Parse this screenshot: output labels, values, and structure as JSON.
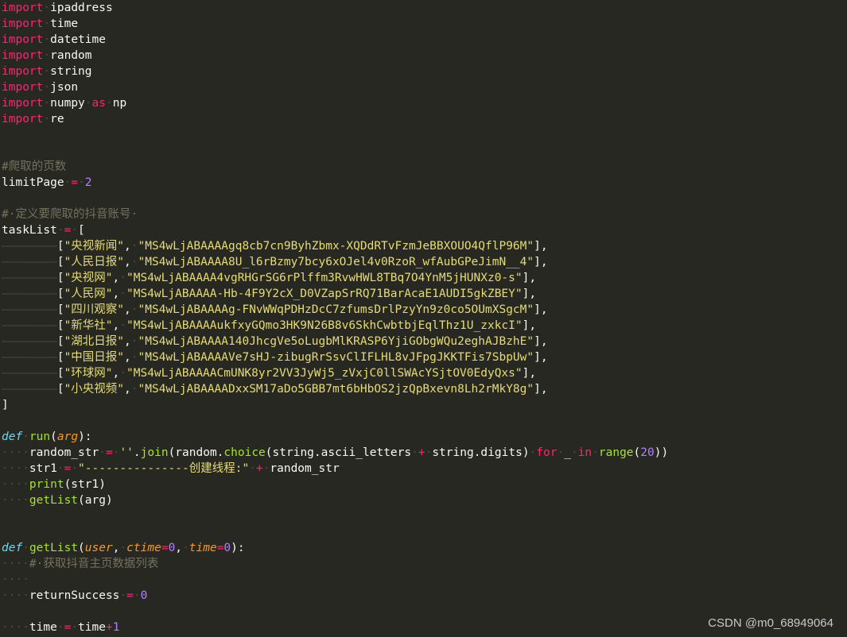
{
  "code": {
    "lines": [
      [
        [
          "kw",
          "import"
        ],
        [
          "ws",
          "·"
        ],
        [
          "t",
          "ipaddress"
        ]
      ],
      [
        [
          "kw",
          "import"
        ],
        [
          "ws",
          "·"
        ],
        [
          "t",
          "time"
        ]
      ],
      [
        [
          "kw",
          "import"
        ],
        [
          "ws",
          "·"
        ],
        [
          "t",
          "datetime"
        ]
      ],
      [
        [
          "kw",
          "import"
        ],
        [
          "ws",
          "·"
        ],
        [
          "t",
          "random"
        ]
      ],
      [
        [
          "kw",
          "import"
        ],
        [
          "ws",
          "·"
        ],
        [
          "t",
          "string"
        ]
      ],
      [
        [
          "kw",
          "import"
        ],
        [
          "ws",
          "·"
        ],
        [
          "t",
          "json"
        ]
      ],
      [
        [
          "kw",
          "import"
        ],
        [
          "ws",
          "·"
        ],
        [
          "t",
          "numpy"
        ],
        [
          "ws",
          "·"
        ],
        [
          "kw",
          "as"
        ],
        [
          "ws",
          "·"
        ],
        [
          "t",
          "np"
        ]
      ],
      [
        [
          "kw",
          "import"
        ],
        [
          "ws",
          "·"
        ],
        [
          "t",
          "re"
        ]
      ],
      [],
      [],
      [
        [
          "cmt",
          "#爬取的页数"
        ]
      ],
      [
        [
          "t",
          "limitPage"
        ],
        [
          "ws",
          "·"
        ],
        [
          "kw",
          "="
        ],
        [
          "ws",
          "·"
        ],
        [
          "num",
          "2"
        ]
      ],
      [],
      [
        [
          "cmt",
          "#·定义要爬取的抖音账号·"
        ]
      ],
      [
        [
          "t",
          "taskList"
        ],
        [
          "ws",
          "·"
        ],
        [
          "kw",
          "="
        ],
        [
          "ws",
          "·"
        ],
        [
          "t",
          "["
        ]
      ],
      [
        [
          "ws",
          "————————"
        ],
        [
          "t",
          "["
        ],
        [
          "str",
          "\"央视新闻\""
        ],
        [
          "t",
          ","
        ],
        [
          "ws",
          "·"
        ],
        [
          "str",
          "\"MS4wLjABAAAAgq8cb7cn9ByhZbmx-XQDdRTvFzmJeBBXOUO4QflP96M\""
        ],
        [
          "t",
          "],"
        ]
      ],
      [
        [
          "ws",
          "————————"
        ],
        [
          "t",
          "["
        ],
        [
          "str",
          "\"人民日报\""
        ],
        [
          "t",
          ","
        ],
        [
          "ws",
          "·"
        ],
        [
          "str",
          "\"MS4wLjABAAAA8U_l6rBzmy7bcy6xOJel4v0RzoR_wfAubGPeJimN__4\""
        ],
        [
          "t",
          "],"
        ]
      ],
      [
        [
          "ws",
          "————————"
        ],
        [
          "t",
          "["
        ],
        [
          "str",
          "\"央视网\""
        ],
        [
          "t",
          ","
        ],
        [
          "ws",
          "·"
        ],
        [
          "str",
          "\"MS4wLjABAAAA4vgRHGrSG6rPlffm3RvwHWL8TBq7O4YnM5jHUNXz0-s\""
        ],
        [
          "t",
          "],"
        ]
      ],
      [
        [
          "ws",
          "————————"
        ],
        [
          "t",
          "["
        ],
        [
          "str",
          "\"人民网\""
        ],
        [
          "t",
          ","
        ],
        [
          "ws",
          "·"
        ],
        [
          "str",
          "\"MS4wLjABAAAA-Hb-4F9Y2cX_D0VZapSrRQ71BarAcaE1AUDI5gkZBEY\""
        ],
        [
          "t",
          "],"
        ]
      ],
      [
        [
          "ws",
          "————————"
        ],
        [
          "t",
          "["
        ],
        [
          "str",
          "\"四川观察\""
        ],
        [
          "t",
          ","
        ],
        [
          "ws",
          "·"
        ],
        [
          "str",
          "\"MS4wLjABAAAAg-FNvWWqPDHzDcC7zfumsDrlPzyYn9z0co5OUmXSgcM\""
        ],
        [
          "t",
          "],"
        ]
      ],
      [
        [
          "ws",
          "————————"
        ],
        [
          "t",
          "["
        ],
        [
          "str",
          "\"新华社\""
        ],
        [
          "t",
          ","
        ],
        [
          "ws",
          "·"
        ],
        [
          "str",
          "\"MS4wLjABAAAAukfxyGQmo3HK9N26B8v6SkhCwbtbjEqlThz1U_zxkcI\""
        ],
        [
          "t",
          "],"
        ]
      ],
      [
        [
          "ws",
          "————————"
        ],
        [
          "t",
          "["
        ],
        [
          "str",
          "\"湖北日报\""
        ],
        [
          "t",
          ","
        ],
        [
          "ws",
          "·"
        ],
        [
          "str",
          "\"MS4wLjABAAAA140JhcgVe5oLugbMlKRASP6YjiGObgWQu2eghAJBzhE\""
        ],
        [
          "t",
          "],"
        ]
      ],
      [
        [
          "ws",
          "————————"
        ],
        [
          "t",
          "["
        ],
        [
          "str",
          "\"中国日报\""
        ],
        [
          "t",
          ","
        ],
        [
          "ws",
          "·"
        ],
        [
          "str",
          "\"MS4wLjABAAAAVe7sHJ-zibugRrSsvClIFLHL8vJFpgJKKTFis7SbpUw\""
        ],
        [
          "t",
          "],"
        ]
      ],
      [
        [
          "ws",
          "————————"
        ],
        [
          "t",
          "["
        ],
        [
          "str",
          "\"环球网\""
        ],
        [
          "t",
          ","
        ],
        [
          "ws",
          "·"
        ],
        [
          "str",
          "\"MS4wLjABAAAACmUNK8yr2VV3JyWj5_zVxjC0llSWAcYSjtOV0EdyQxs\""
        ],
        [
          "t",
          "],"
        ]
      ],
      [
        [
          "ws",
          "————————"
        ],
        [
          "t",
          "["
        ],
        [
          "str",
          "\"小央视频\""
        ],
        [
          "t",
          ","
        ],
        [
          "ws",
          "·"
        ],
        [
          "str",
          "\"MS4wLjABAAAADxxSM17aDo5GBB7mt6bHbOS2jzQpBxevn8Lh2rMkY8g\""
        ],
        [
          "t",
          "],"
        ]
      ],
      [
        [
          "t",
          "]"
        ]
      ],
      [],
      [
        [
          "def",
          "def"
        ],
        [
          "ws",
          "·"
        ],
        [
          "fn",
          "run"
        ],
        [
          "t",
          "("
        ],
        [
          "param",
          "arg"
        ],
        [
          "t",
          "):"
        ]
      ],
      [
        [
          "ws",
          "····"
        ],
        [
          "t",
          "random_str"
        ],
        [
          "ws",
          "·"
        ],
        [
          "kw",
          "="
        ],
        [
          "ws",
          "·"
        ],
        [
          "str",
          "''"
        ],
        [
          "t",
          "."
        ],
        [
          "fn",
          "join"
        ],
        [
          "t",
          "(random."
        ],
        [
          "fn",
          "choice"
        ],
        [
          "t",
          "(string.ascii_letters"
        ],
        [
          "ws",
          "·"
        ],
        [
          "kw",
          "+"
        ],
        [
          "ws",
          "·"
        ],
        [
          "t",
          "string.digits)"
        ],
        [
          "ws",
          "·"
        ],
        [
          "kw",
          "for"
        ],
        [
          "ws",
          "·"
        ],
        [
          "t",
          "_"
        ],
        [
          "ws",
          "·"
        ],
        [
          "kw",
          "in"
        ],
        [
          "ws",
          "·"
        ],
        [
          "fn",
          "range"
        ],
        [
          "t",
          "("
        ],
        [
          "num",
          "20"
        ],
        [
          "t",
          "))"
        ]
      ],
      [
        [
          "ws",
          "····"
        ],
        [
          "t",
          "str1"
        ],
        [
          "ws",
          "·"
        ],
        [
          "kw",
          "="
        ],
        [
          "ws",
          "·"
        ],
        [
          "str",
          "\"---------------创建线程:\""
        ],
        [
          "ws",
          "·"
        ],
        [
          "kw",
          "+"
        ],
        [
          "ws",
          "·"
        ],
        [
          "t",
          "random_str"
        ]
      ],
      [
        [
          "ws",
          "····"
        ],
        [
          "fn",
          "print"
        ],
        [
          "t",
          "(str1)"
        ]
      ],
      [
        [
          "ws",
          "····"
        ],
        [
          "fn",
          "getList"
        ],
        [
          "t",
          "(arg)"
        ]
      ],
      [],
      [],
      [
        [
          "def",
          "def"
        ],
        [
          "ws",
          "·"
        ],
        [
          "fn",
          "getList"
        ],
        [
          "t",
          "("
        ],
        [
          "param",
          "user"
        ],
        [
          "t",
          ","
        ],
        [
          "ws",
          "·"
        ],
        [
          "param",
          "ctime"
        ],
        [
          "kw",
          "="
        ],
        [
          "num",
          "0"
        ],
        [
          "t",
          ","
        ],
        [
          "ws",
          "·"
        ],
        [
          "param",
          "time"
        ],
        [
          "kw",
          "="
        ],
        [
          "num",
          "0"
        ],
        [
          "t",
          "):"
        ]
      ],
      [
        [
          "ws",
          "····"
        ],
        [
          "cmt",
          "#·获取抖音主页数据列表"
        ]
      ],
      [
        [
          "ws",
          "····"
        ]
      ],
      [
        [
          "ws",
          "····"
        ],
        [
          "t",
          "returnSuccess"
        ],
        [
          "ws",
          "·"
        ],
        [
          "kw",
          "="
        ],
        [
          "ws",
          "·"
        ],
        [
          "num",
          "0"
        ]
      ],
      [],
      [
        [
          "ws",
          "····"
        ],
        [
          "t",
          "time"
        ],
        [
          "ws",
          "·"
        ],
        [
          "kw",
          "="
        ],
        [
          "ws",
          "·"
        ],
        [
          "t",
          "time"
        ],
        [
          "kw",
          "+"
        ],
        [
          "num",
          "1"
        ]
      ]
    ]
  },
  "watermark": "CSDN @m0_68949064"
}
